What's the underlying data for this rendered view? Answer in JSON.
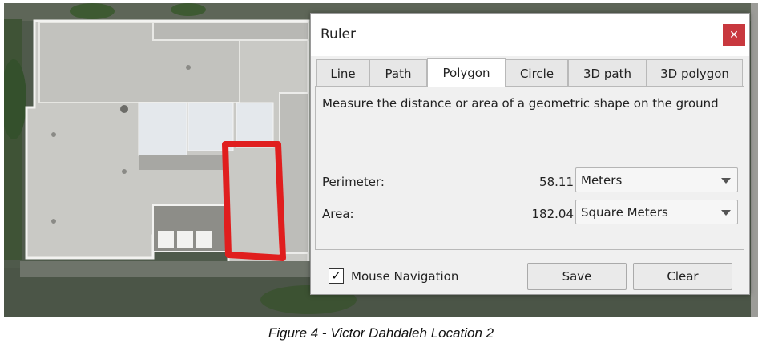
{
  "map": {
    "description": "satellite view of building rooftop",
    "highlight_color": "#e01e1e"
  },
  "dialog": {
    "title": "Ruler",
    "close_glyph": "✕",
    "tabs": [
      {
        "label": "Line",
        "active": false
      },
      {
        "label": "Path",
        "active": false
      },
      {
        "label": "Polygon",
        "active": true
      },
      {
        "label": "Circle",
        "active": false
      },
      {
        "label": "3D path",
        "active": false
      },
      {
        "label": "3D polygon",
        "active": false
      }
    ],
    "description": "Measure the distance or area of a geometric shape on the ground",
    "perimeter": {
      "label": "Perimeter:",
      "value": "58.11",
      "unit": "Meters"
    },
    "area": {
      "label": "Area:",
      "value": "182.04",
      "unit": "Square Meters"
    },
    "mouse_navigation": {
      "label": "Mouse Navigation",
      "checked": true,
      "check_glyph": "✓"
    },
    "save_label": "Save",
    "clear_label": "Clear"
  },
  "caption": "Figure 4 - Victor Dahdaleh Location 2"
}
